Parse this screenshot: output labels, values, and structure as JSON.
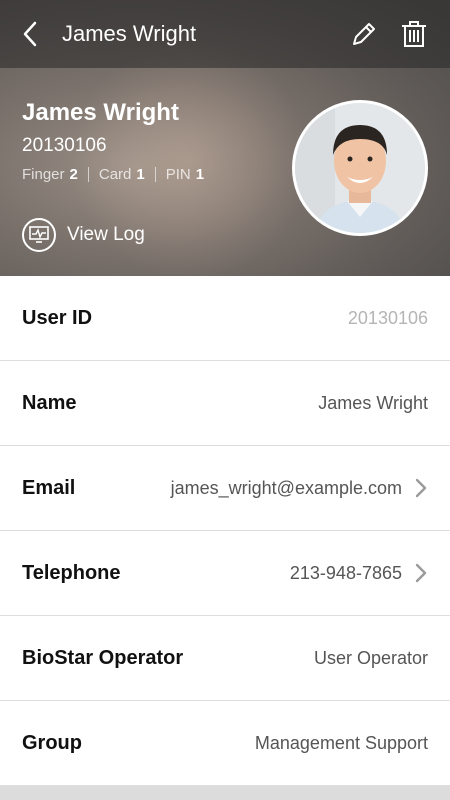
{
  "header": {
    "title": "James Wright",
    "back_icon": "chevron-left-icon",
    "edit_icon": "pencil-icon",
    "delete_icon": "trash-icon"
  },
  "profile": {
    "name": "James Wright",
    "user_id": "20130106",
    "credentials": [
      {
        "label": "Finger",
        "count": "2"
      },
      {
        "label": "Card",
        "count": "1"
      },
      {
        "label": "PIN",
        "count": "1"
      }
    ],
    "view_log_label": "View Log",
    "view_log_icon": "activity-log-icon"
  },
  "fields": [
    {
      "label": "User ID",
      "value": "20130106",
      "editable": false,
      "chevron": false
    },
    {
      "label": "Name",
      "value": "James Wright",
      "editable": true,
      "chevron": false
    },
    {
      "label": "Email",
      "value": "james_wright@example.com",
      "editable": true,
      "chevron": true
    },
    {
      "label": "Telephone",
      "value": "213-948-7865",
      "editable": true,
      "chevron": true
    },
    {
      "label": "BioStar Operator",
      "value": "User Operator",
      "editable": true,
      "chevron": false
    },
    {
      "label": "Group",
      "value": "Management Support",
      "editable": true,
      "chevron": false
    }
  ],
  "colors": {
    "header_text": "#ffffff",
    "label_text": "#111111",
    "value_text": "#555555",
    "muted_value": "#b5b5b5",
    "divider": "#dedede"
  }
}
